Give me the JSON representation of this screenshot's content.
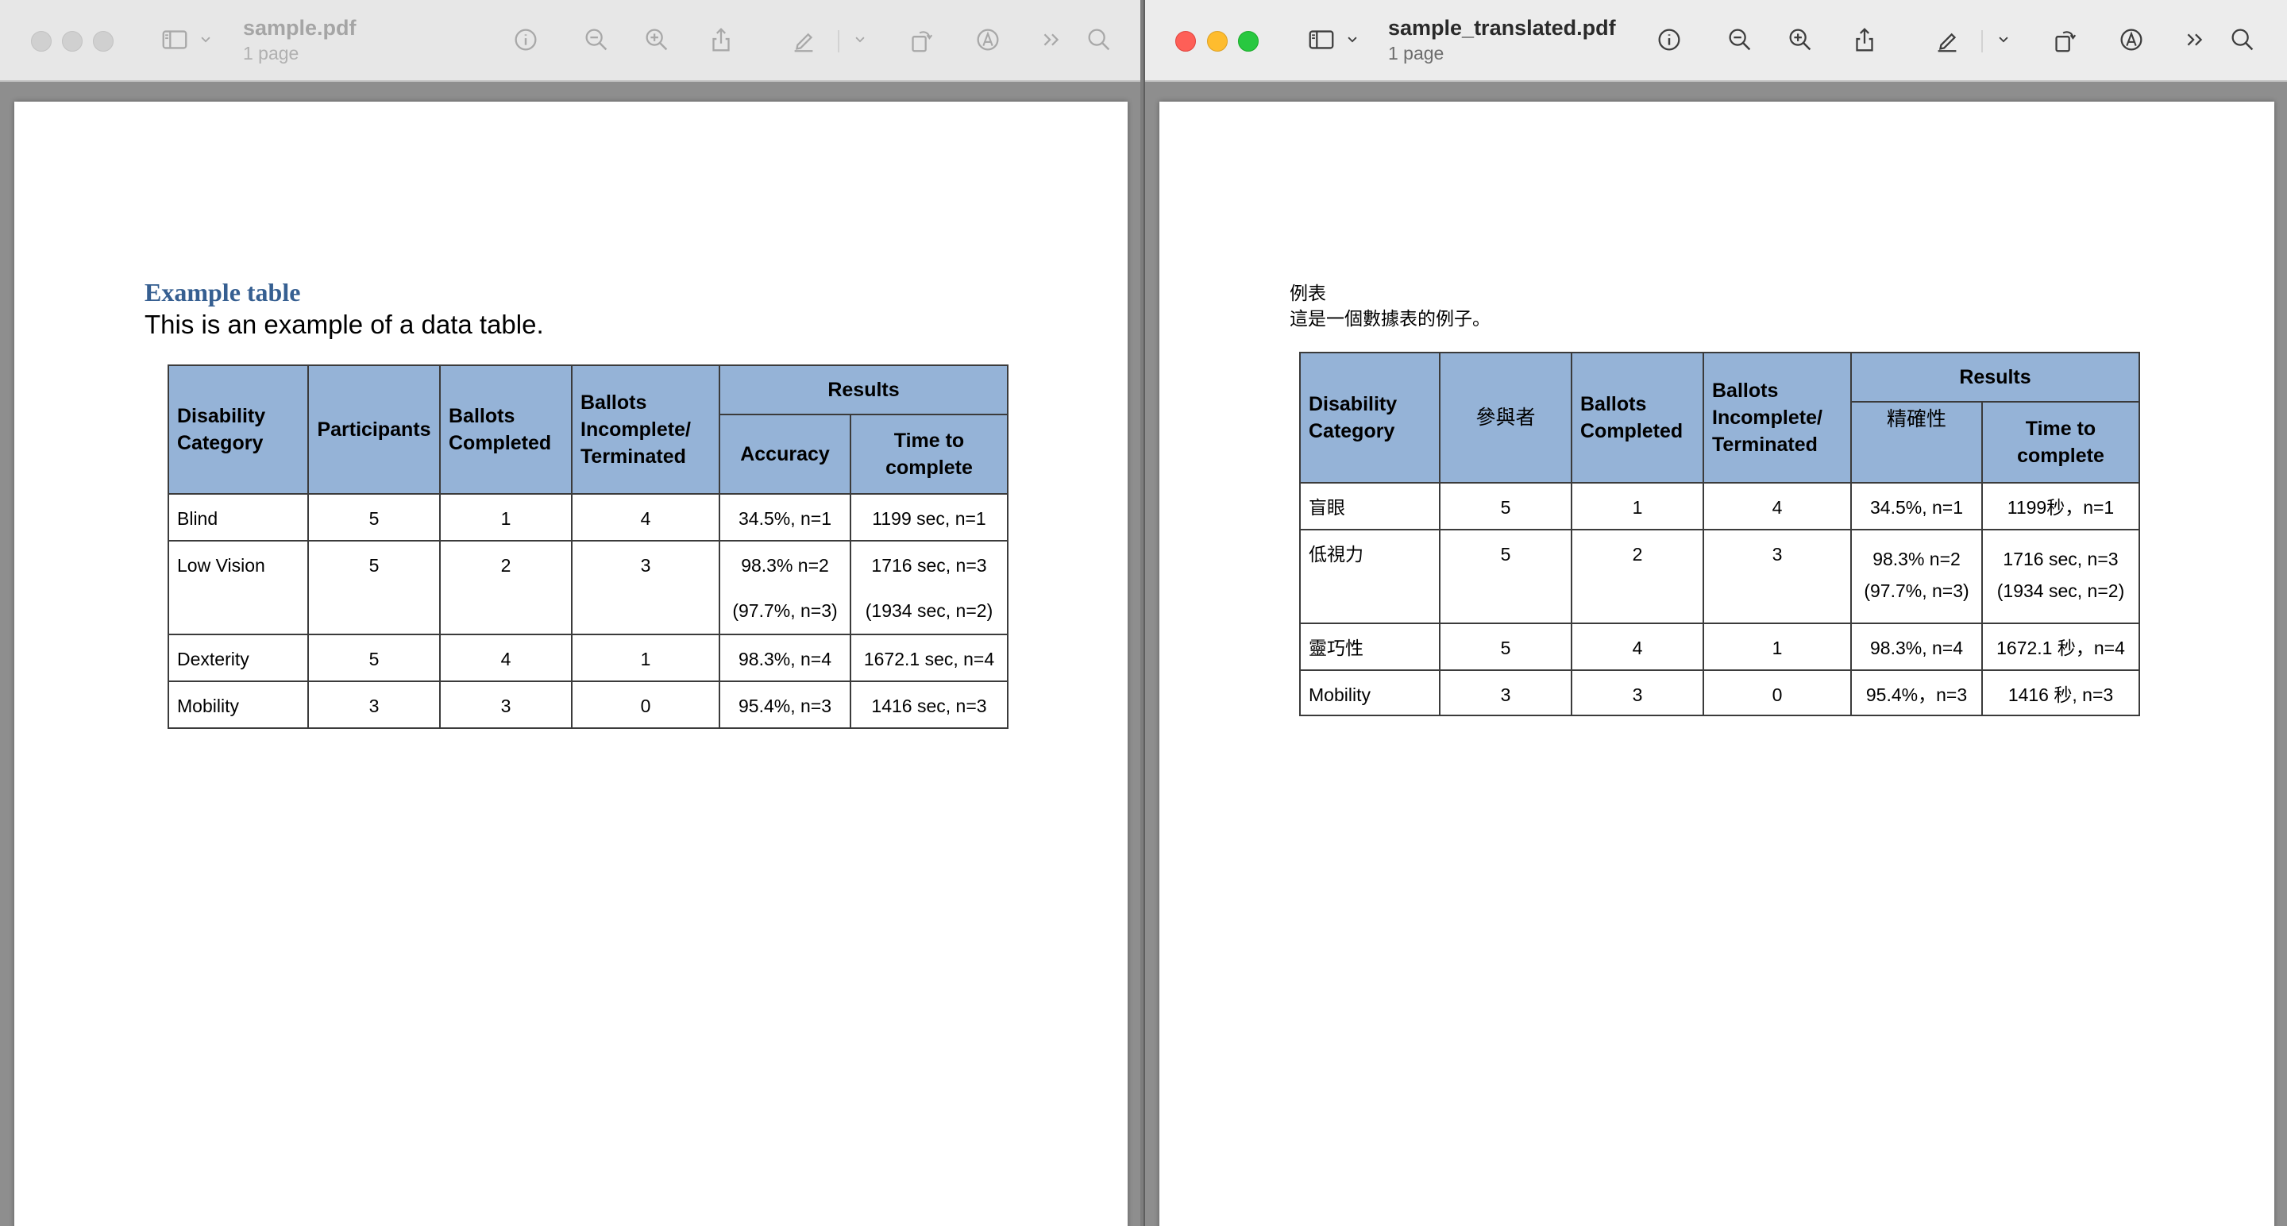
{
  "left_window": {
    "title": "sample.pdf",
    "subtitle": "1 page",
    "heading": "Example table",
    "description": "This is an example of a data table.",
    "table": {
      "h_disability": "Disability Category",
      "h_participants": "Participants",
      "h_ballots_completed": "Ballots Completed",
      "h_ballots_incomplete": "Ballots Incomplete/ Terminated",
      "h_results": "Results",
      "h_accuracy": "Accuracy",
      "h_time": "Time to complete",
      "rows": [
        {
          "category": "Blind",
          "participants": "5",
          "completed": "1",
          "incomplete": "4",
          "accuracy": "34.5%, n=1",
          "accuracy2": "",
          "time": "1199 sec, n=1",
          "time2": ""
        },
        {
          "category": "Low Vision",
          "participants": "5",
          "completed": "2",
          "incomplete": "3",
          "accuracy": "98.3% n=2",
          "accuracy2": "(97.7%, n=3)",
          "time": "1716 sec, n=3",
          "time2": "(1934 sec, n=2)"
        },
        {
          "category": "Dexterity",
          "participants": "5",
          "completed": "4",
          "incomplete": "1",
          "accuracy": "98.3%, n=4",
          "accuracy2": "",
          "time": "1672.1 sec, n=4",
          "time2": ""
        },
        {
          "category": "Mobility",
          "participants": "3",
          "completed": "3",
          "incomplete": "0",
          "accuracy": "95.4%, n=3",
          "accuracy2": "",
          "time": "1416 sec, n=3",
          "time2": ""
        }
      ]
    }
  },
  "right_window": {
    "title": "sample_translated.pdf",
    "subtitle": "1 page",
    "heading": "例表",
    "description": "這是一個數據表的例子。",
    "table": {
      "h_disability": "Disability Category",
      "h_participants": "參與者",
      "h_ballots_completed": "Ballots Completed",
      "h_ballots_incomplete": "Ballots Incomplete/ Terminated",
      "h_results": "Results",
      "h_accuracy": "精確性",
      "h_time": "Time to complete",
      "rows": [
        {
          "category": "盲眼",
          "participants": "5",
          "completed": "1",
          "incomplete": "4",
          "accuracy": "34.5%, n=1",
          "accuracy2": "",
          "time": "1199秒，n=1",
          "time2": ""
        },
        {
          "category": "低視力",
          "participants": "5",
          "completed": "2",
          "incomplete": "3",
          "accuracy": "98.3% n=2",
          "accuracy2": "(97.7%, n=3)",
          "time": "1716 sec, n=3",
          "time2": "(1934 sec, n=2)"
        },
        {
          "category": "靈巧性",
          "participants": "5",
          "completed": "4",
          "incomplete": "1",
          "accuracy": "98.3%, n=4",
          "accuracy2": "",
          "time": "1672.1 秒，n=4",
          "time2": ""
        },
        {
          "category": "Mobility",
          "participants": "3",
          "completed": "3",
          "incomplete": "0",
          "accuracy": "95.4%，n=3",
          "accuracy2": "",
          "time": "1416 秒, n=3",
          "time2": ""
        }
      ]
    }
  },
  "toolbar_icons": [
    "sidebar-icon",
    "chevron-down-icon",
    "info-icon",
    "zoom-out-icon",
    "zoom-in-icon",
    "share-icon",
    "markup-pen-icon",
    "chevron-down-icon",
    "rotate-icon",
    "annotate-icon",
    "more-chevrons-icon",
    "search-icon"
  ]
}
